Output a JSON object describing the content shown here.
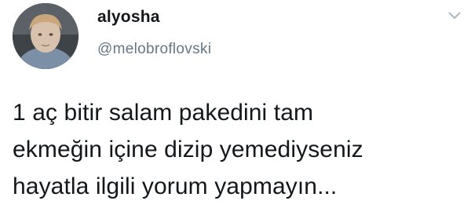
{
  "author": {
    "display_name": "alyosha",
    "username": "@melobroflovski"
  },
  "tweet": {
    "lines": [
      "1 aç bitir salam pakedini tam",
      "ekmeğin içine dizip yemediyseniz",
      "hayatla ilgili yorum yapmayın..."
    ]
  },
  "icons": {
    "avatar": "profile-photo",
    "menu": "chevron-down-icon"
  },
  "colors": {
    "text": "#14171a",
    "secondary": "#657786",
    "caret": "#aab8c2"
  }
}
